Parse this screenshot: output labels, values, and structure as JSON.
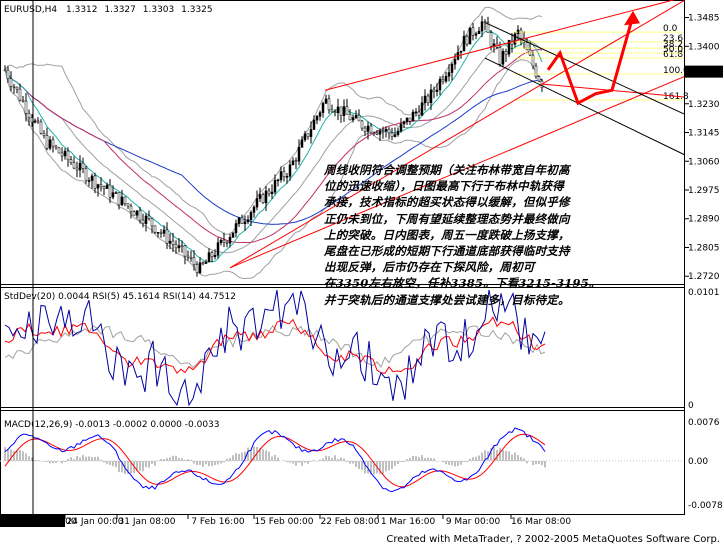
{
  "chart_data": [
    {
      "type": "candlestick",
      "title": "EURUSD,H4",
      "ohlc_header": [
        "1.3312",
        "1.3327",
        "1.3303",
        "1.3325"
      ],
      "price_axis_labels": [
        "1.3485",
        "1.3400",
        "1.3320",
        "1.3230",
        "1.3145",
        "1.3060",
        "1.2975",
        "1.2890",
        "1.2805",
        "1.2720"
      ],
      "current_price": "1.3325",
      "fibonacci_levels": [
        "0.0",
        "61.8",
        "100.0",
        "23.6",
        "161.8",
        "38.2",
        "50.0"
      ],
      "ylim": [
        1.27,
        1.3525
      ],
      "annotations": [
        "周线收阴符合调整预期（关注布林带宽自年初高",
        "位的迅速收缩），日图最高下行于布林中轨获得",
        "承接，技术指标的超买状态得以缓解，但似乎修",
        "正仍未到位，下周有望延续整理态势并最终做向",
        "上的突破。日内图表，周五一度跌破上扬支撑，",
        "尾盘在已形成的短期下行通道底部获得临时支持",
        "出现反弹，后市仍存在下探风险，周初可",
        "在3350左右放空，任补3385。下看3215-3195。",
        "并于突轨后的通道支撑处尝试建多，目标待定。"
      ]
    },
    {
      "type": "line",
      "title": "StdDev(20) 0.0044  RSI(5) 45.1614  RSI(14) 44.7512",
      "axis_labels": [
        "0.0101",
        "0"
      ]
    },
    {
      "type": "bar",
      "title": "MACD(12,26,9) -0.0013 -0.0002 0.0000 -0.0033",
      "axis_labels": [
        "0.0076",
        "0.00",
        "-0.0078"
      ]
    }
  ],
  "time_axis": {
    "cursor_label": "2005.01.19 4:00",
    "labels": [
      "24 Jan 00:00",
      "31 Jan 08:00",
      "7 Feb 16:00",
      "15 Feb 00:00",
      "22 Feb 08:00",
      "1 Mar 16:00",
      "9 Mar 00:00",
      "16 Mar 08:00"
    ]
  },
  "footer": "Created with MetaTrader, ? 2002-2005 MetaQuotes Software Corp.",
  "colors": {
    "bull_candle": "#000000",
    "bear_candle": "#ffffff",
    "channel": "#ff0000",
    "bollinger": "#a0a0a0",
    "ma_fast": "#20b2aa",
    "ma_slow": "#1e3cc8",
    "ma_mid": "#c0306a",
    "fib": "#ffff00",
    "rsi5": "#0000a0",
    "rsi14": "#ff0000",
    "macd_main": "#0000ff",
    "macd_signal": "#ff0000"
  }
}
